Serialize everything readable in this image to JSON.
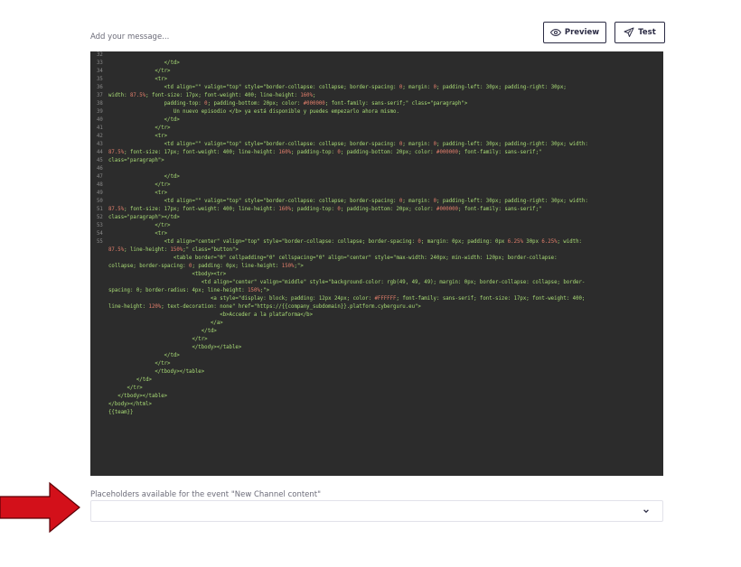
{
  "message": {
    "placeholder": "Add your message..."
  },
  "toolbar": {
    "preview_label": "Preview",
    "test_label": "Test"
  },
  "editor": {
    "lines": [
      {
        "n": "32",
        "t": ""
      },
      {
        "n": "33",
        "t": "                  </td>"
      },
      {
        "n": "34",
        "t": "               </tr>"
      },
      {
        "n": "35",
        "t": "               <tr>"
      },
      {
        "n": "36",
        "t": "                  <td align=\"\" valign=\"top\" style=\"border-collapse: collapse; border-spacing: 0; margin: 0; padding-left: 30px; padding-right: 30px;"
      },
      {
        "n": "37",
        "t": "width: 87.5%; font-size: 17px; font-weight: 400; line-height: 160%;"
      },
      {
        "n": "38",
        "t": "                  padding-top: 0; padding-bottom: 20px; color: #000000; font-family: sans-serif;\" class=\"paragraph\">"
      },
      {
        "n": "39",
        "t": "                     Un nuevo episodio </b> ya está disponible y puedes empezarlo ahora mismo."
      },
      {
        "n": "40",
        "t": "                  </td>"
      },
      {
        "n": "41",
        "t": "               </tr>"
      },
      {
        "n": "42",
        "t": "               <tr>"
      },
      {
        "n": "43",
        "t": "                  <td align=\"\" valign=\"top\" style=\"border-collapse: collapse; border-spacing: 0; margin: 0; padding-left: 30px; padding-right: 30px; width:"
      },
      {
        "n": "44",
        "t": "87.5%; font-size: 17px; font-weight: 400; line-height: 160%; padding-top: 0; padding-bottom: 20px; color: #000000; font-family: sans-serif;\""
      },
      {
        "n": "45",
        "t": "class=\"paragraph\">"
      },
      {
        "n": "46",
        "t": ""
      },
      {
        "n": "47",
        "t": "                  </td>"
      },
      {
        "n": "48",
        "t": "               </tr>"
      },
      {
        "n": "49",
        "t": "               <tr>"
      },
      {
        "n": "50",
        "t": "                  <td align=\"\" valign=\"top\" style=\"border-collapse: collapse; border-spacing: 0; margin: 0; padding-left: 30px; padding-right: 30px; width:"
      },
      {
        "n": "51",
        "t": "87.5%; font-size: 17px; font-weight: 400; line-height: 160%; padding-top: 0; padding-bottom: 20px; color: #000000; font-family: sans-serif;\""
      },
      {
        "n": "52",
        "t": "class=\"paragraph\"></td>"
      },
      {
        "n": "53",
        "t": "               </tr>"
      },
      {
        "n": "54",
        "t": "               <tr>"
      },
      {
        "n": "55",
        "t": "                  <td align=\"center\" valign=\"top\" style=\"border-collapse: collapse; border-spacing: 0; margin: 0px; padding: 0px 6.25% 30px 6.25%; width:"
      },
      {
        "n": "",
        "t": "87.5%; line-height: 150%;\" class=\"button\">"
      },
      {
        "n": "",
        "t": "                     <table border=\"0\" cellpadding=\"0\" cellspacing=\"0\" align=\"center\" style=\"max-width: 240px; min-width: 120px; border-collapse:"
      },
      {
        "n": "",
        "t": "collapse; border-spacing: 0; padding: 0px; line-height: 150%;\">"
      },
      {
        "n": "",
        "t": "                           <tbody><tr>"
      },
      {
        "n": "",
        "t": "                              <td align=\"center\" valign=\"middle\" style=\"background-color: rgb(49, 49, 49); margin: 0px; border-collapse: collapse; border-"
      },
      {
        "n": "",
        "t": "spacing: 0; border-radius: 4px; line-height: 150%;\">"
      },
      {
        "n": "",
        "t": "                                 <a style=\"display: block; padding: 12px 24px; color: #FFFFFF; font-family: sans-serif; font-size: 17px; font-weight: 400;"
      },
      {
        "n": "",
        "t": "line-height: 120%; text-decoration: none\" href=\"https://{{company_subdomain}}.platform.cyberguru.eu\">"
      },
      {
        "n": "",
        "t": "                                    <b>Acceder a la plataforma</b>"
      },
      {
        "n": "",
        "t": "                                 </a>"
      },
      {
        "n": "",
        "t": "                              </td>"
      },
      {
        "n": "",
        "t": "                           </tr>"
      },
      {
        "n": "",
        "t": "                           </tbody></table>"
      },
      {
        "n": "",
        "t": "                  </td>"
      },
      {
        "n": "",
        "t": "               </tr>"
      },
      {
        "n": "",
        "t": "               </tbody></table>"
      },
      {
        "n": "",
        "t": "         </td>"
      },
      {
        "n": "",
        "t": "      </tr>"
      },
      {
        "n": "",
        "t": "   </tbody></table>"
      },
      {
        "n": "",
        "t": "</body></html>"
      },
      {
        "n": "",
        "t": "{{team}}"
      }
    ]
  },
  "placeholders": {
    "label": "Placeholders available for the event \"New Channel content\"",
    "selected": ""
  },
  "colors": {
    "editor_bg": "#2c2c2c",
    "code_green": "#a9dc76",
    "code_number": "#e37f6b",
    "arrow_red": "#d3101a",
    "button_text": "#2b2b44"
  },
  "icons": {
    "preview": "eye-icon",
    "test": "send-icon",
    "dropdown": "chevron-down-icon",
    "annotation": "red-arrow"
  }
}
